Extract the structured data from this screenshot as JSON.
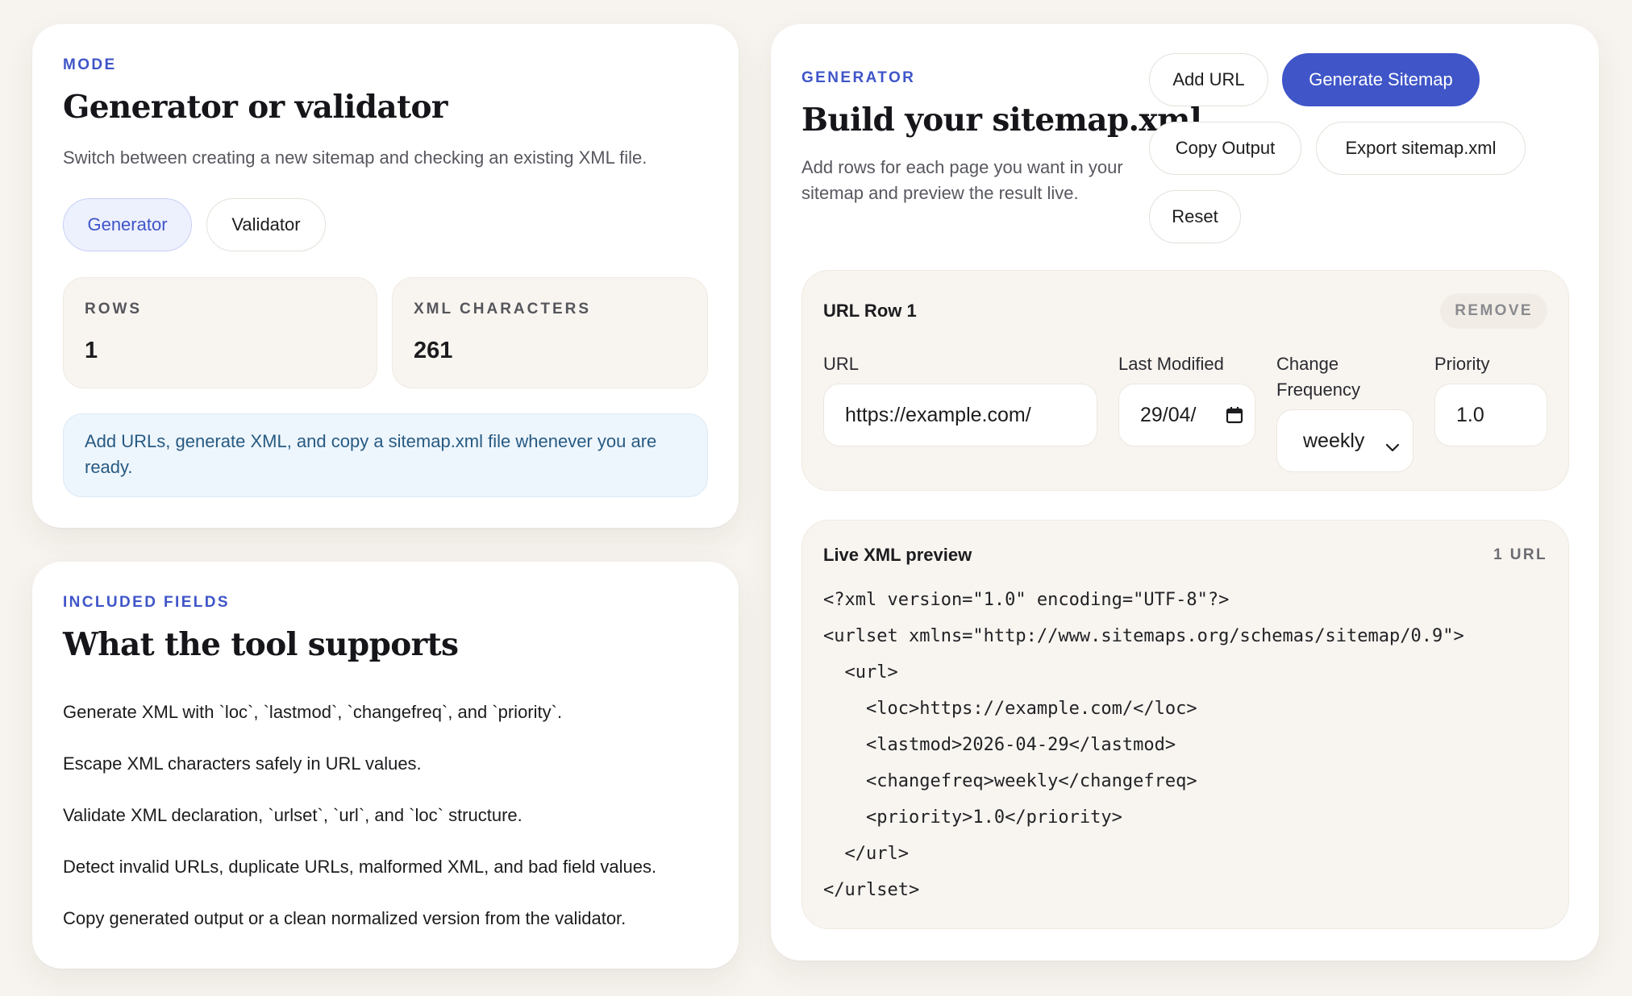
{
  "mode_card": {
    "eyebrow": "MODE",
    "title": "Generator or validator",
    "description": "Switch between creating a new sitemap and checking an existing XML file.",
    "modes": [
      {
        "label": "Generator",
        "active": true
      },
      {
        "label": "Validator",
        "active": false
      }
    ],
    "stats": [
      {
        "label": "ROWS",
        "value": "1"
      },
      {
        "label": "XML CHARACTERS",
        "value": "261"
      }
    ],
    "note": "Add URLs, generate XML, and copy a sitemap.xml file whenever you are ready."
  },
  "fields_card": {
    "eyebrow": "INCLUDED FIELDS",
    "title": "What the tool supports",
    "features": [
      "Generate XML with `loc`, `lastmod`, `changefreq`, and `priority`.",
      "Escape XML characters safely in URL values.",
      "Validate XML declaration, `urlset`, `url`, and `loc` structure.",
      "Detect invalid URLs, duplicate URLs, malformed XML, and bad field values.",
      "Copy generated output or a clean normalized version from the validator."
    ]
  },
  "generator_card": {
    "eyebrow": "GENERATOR",
    "title": "Build your sitemap.xml",
    "description": "Add rows for each page you want in your sitemap and preview the result live.",
    "actions": {
      "add_url": "Add URL",
      "generate": "Generate Sitemap",
      "copy": "Copy Output",
      "export": "Export sitemap.xml",
      "reset": "Reset"
    },
    "url_row": {
      "title": "URL Row 1",
      "remove_label": "REMOVE",
      "url_label": "URL",
      "url_value": "https://example.com/",
      "lastmod_label": "Last Modified",
      "lastmod_value": "29/04/",
      "changefreq_label": "Change Frequency",
      "changefreq_value": "weekly",
      "priority_label": "Priority",
      "priority_value": "1.0"
    },
    "preview": {
      "title": "Live XML preview",
      "count": "1 URL",
      "lines": [
        "<?xml version=\"1.0\" encoding=\"UTF-8\"?>",
        "<urlset xmlns=\"http://www.sitemaps.org/schemas/sitemap/0.9\">",
        "  <url>",
        "    <loc>https://example.com/</loc>",
        "    <lastmod>2026-04-29</lastmod>",
        "    <changefreq>weekly</changefreq>",
        "    <priority>1.0</priority>",
        "  </url>",
        "</urlset>"
      ]
    }
  },
  "colors": {
    "accent": "#3f55c8",
    "page_background": "#f7f4ef",
    "note_background": "#eef6fd",
    "note_text": "#275a82"
  },
  "icons": {
    "date_picker": "calendar-icon",
    "select_arrow": "chevron-down-icon"
  }
}
